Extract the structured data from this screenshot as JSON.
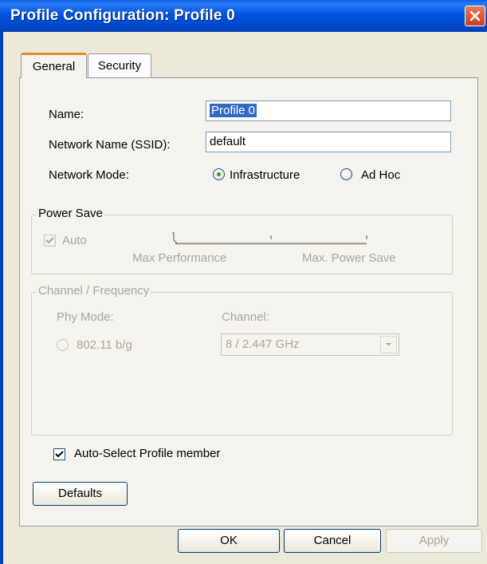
{
  "window": {
    "title": "Profile Configuration: Profile 0"
  },
  "tabs": [
    {
      "label": "General",
      "active": true
    },
    {
      "label": "Security",
      "active": false
    }
  ],
  "general": {
    "name_label": "Name:",
    "name_value": "Profile 0",
    "ssid_label": "Network Name (SSID):",
    "ssid_value": "default",
    "mode_label": "Network Mode:",
    "mode_options": [
      "Infrastructure",
      "Ad Hoc"
    ],
    "mode_selected": "Infrastructure"
  },
  "power_save": {
    "title": "Power Save",
    "auto_label": "Auto",
    "auto_checked": true,
    "enabled": false,
    "slider_min_label": "Max Performance",
    "slider_max_label": "Max. Power Save",
    "slider_level": 0
  },
  "channel": {
    "title": "Channel / Frequency",
    "phy_mode_label": "Phy Mode:",
    "phy_mode_option": "802.11 b/g",
    "channel_label": "Channel:",
    "channel_value": "8 / 2.447 GHz",
    "enabled": false
  },
  "auto_select": {
    "label": "Auto-Select Profile member",
    "checked": true
  },
  "buttons": {
    "defaults": "Defaults",
    "ok": "OK",
    "cancel": "Cancel",
    "apply": "Apply"
  },
  "colors": {
    "titlebar": "#0053e1",
    "dialog_bg": "#ece9d8",
    "selection": "#316ac5"
  }
}
